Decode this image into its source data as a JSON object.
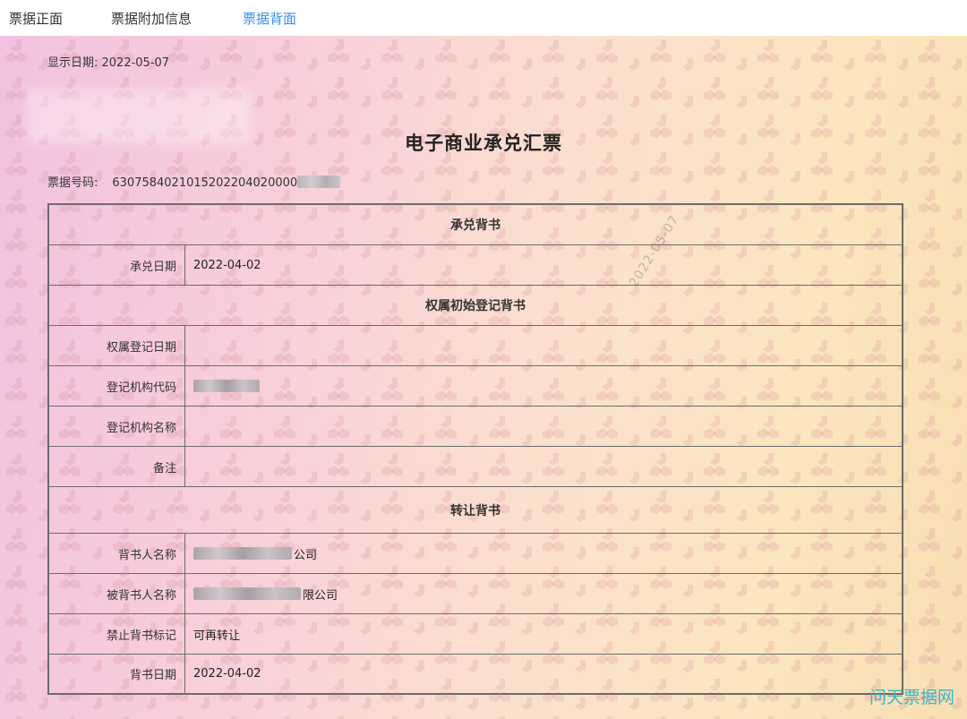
{
  "tabs": [
    {
      "label": "票据正面",
      "active": false
    },
    {
      "label": "票据附加信息",
      "active": false
    },
    {
      "label": "票据背面",
      "active": true
    }
  ],
  "display_date": "显示日期: 2022-05-07",
  "title": "电子商业承兑汇票",
  "bill_number": {
    "label": "票据号码:",
    "value": "6307584021015202204020000"
  },
  "sections": {
    "acceptance": {
      "heading": "承兑背书",
      "rows": [
        {
          "label": "承兑日期",
          "value": "2022-04-02"
        }
      ]
    },
    "ownership": {
      "heading": "权属初始登记背书",
      "rows": [
        {
          "label": "权属登记日期",
          "value": ""
        },
        {
          "label": "登记机构代码",
          "value": ""
        },
        {
          "label": "登记机构名称",
          "value": ""
        },
        {
          "label": "备注",
          "value": ""
        }
      ]
    },
    "transfer": {
      "heading": "转让背书",
      "rows": [
        {
          "label": "背书人名称",
          "value": "公司"
        },
        {
          "label": "被背书人名称",
          "value": "限公司"
        },
        {
          "label": "禁止背书标记",
          "value": "可再转让"
        },
        {
          "label": "背书日期",
          "value": "2022-04-02"
        }
      ]
    }
  },
  "stamp_text": "2022-05-07",
  "watermark": "问天票据网",
  "colors": {
    "active_tab": "#3a8ee6",
    "watermark": "#38b6c8",
    "table_border": "#6b6b6b"
  }
}
